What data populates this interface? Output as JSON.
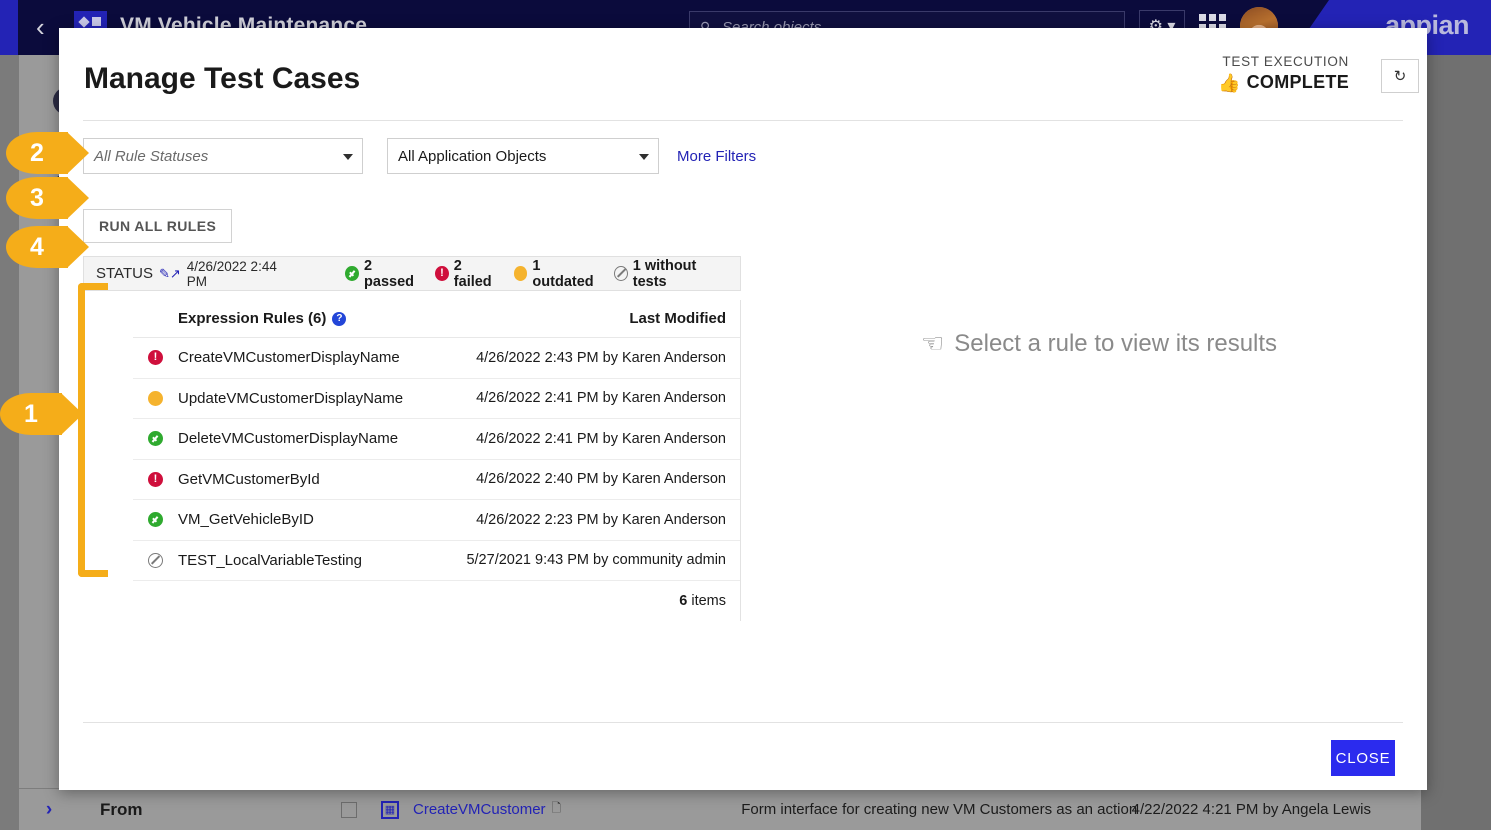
{
  "background": {
    "app_title": "VM Vehicle Maintenance",
    "back_icon": "chevron-left-icon",
    "app_logo_icon": "app-grid-logo-icon",
    "search_placeholder": "Search objects",
    "search_icon": "search-icon",
    "gear_icon": "gear-icon",
    "grid_icon": "apps-grid-icon",
    "avatar_icon": "user-avatar",
    "brand": "appian",
    "rail_icons": [
      "compass-icon",
      "tag-icon",
      "gauge-icon"
    ],
    "down_arrow_icon": "download-arrow-icon",
    "from_label": "From",
    "from_chevron_icon": "chevron-right-icon",
    "bottom_row": {
      "checkbox_icon": "checkbox-icon",
      "type_icon": "interface-icon",
      "name": "CreateVMCustomer",
      "copy_icon": "copy-icon",
      "description": "Form interface for creating new VM Customers as an action",
      "modified": "4/22/2022 4:21 PM by Angela Lewis"
    }
  },
  "modal": {
    "title": "Manage Test Cases",
    "execution": {
      "label": "TEST EXECUTION",
      "value": "COMPLETE",
      "thumb_icon": "thumbs-up-icon",
      "thumb_color": "#2323b5",
      "refresh_icon": "refresh-icon"
    },
    "filters": {
      "status_select_value": "All Rule Statuses",
      "objects_select_value": "All Application Objects",
      "more_filters_label": "More Filters",
      "more_filters_color": "#2323b5",
      "caret_icon": "chevron-down-icon"
    },
    "run_all_label": "RUN ALL RULES",
    "status_strip": {
      "label": "STATUS",
      "edit_icon": "edit-external-icon",
      "timestamp": "4/26/2022 2:44 PM",
      "counts": [
        {
          "icon": "check-circle-icon",
          "kind": "pass",
          "text": "2 passed"
        },
        {
          "icon": "exclamation-circle-icon",
          "kind": "fail",
          "text": "2 failed"
        },
        {
          "icon": "dot-circle-icon",
          "kind": "outdated",
          "text": "1 outdated"
        },
        {
          "icon": "no-tests-icon",
          "kind": "none",
          "text": "1 without tests"
        }
      ]
    },
    "table": {
      "col_name": "Expression Rules (6)",
      "help_icon": "help-circle-icon",
      "col_modified": "Last Modified",
      "rows": [
        {
          "status": "fail",
          "status_icon": "exclamation-circle-icon",
          "name": "CreateVMCustomerDisplayName",
          "modified": "4/26/2022 2:43 PM by Karen Anderson"
        },
        {
          "status": "outdated",
          "status_icon": "dot-circle-icon",
          "name": "UpdateVMCustomerDisplayName",
          "modified": "4/26/2022 2:41 PM by Karen Anderson"
        },
        {
          "status": "pass",
          "status_icon": "check-circle-icon",
          "name": "DeleteVMCustomerDisplayName",
          "modified": "4/26/2022 2:41 PM by Karen Anderson"
        },
        {
          "status": "fail",
          "status_icon": "exclamation-circle-icon",
          "name": "GetVMCustomerById",
          "modified": "4/26/2022 2:40 PM by Karen Anderson"
        },
        {
          "status": "pass",
          "status_icon": "check-circle-icon",
          "name": "VM_GetVehicleByID",
          "modified": "4/26/2022 2:23 PM by Karen Anderson"
        },
        {
          "status": "none",
          "status_icon": "no-tests-icon",
          "name": "TEST_LocalVariableTesting",
          "modified": "5/27/2021 9:43 PM by community admin"
        }
      ],
      "footer_count": "6",
      "footer_label": "items"
    },
    "empty_state": {
      "icon": "pointer-hand-icon",
      "text": "Select a rule to view its results"
    },
    "close_label": "CLOSE",
    "close_color": "#2b2bee"
  },
  "annotations": {
    "color": "#f5ad19",
    "callouts": [
      {
        "number": "1"
      },
      {
        "number": "2"
      },
      {
        "number": "3"
      },
      {
        "number": "4"
      }
    ]
  }
}
